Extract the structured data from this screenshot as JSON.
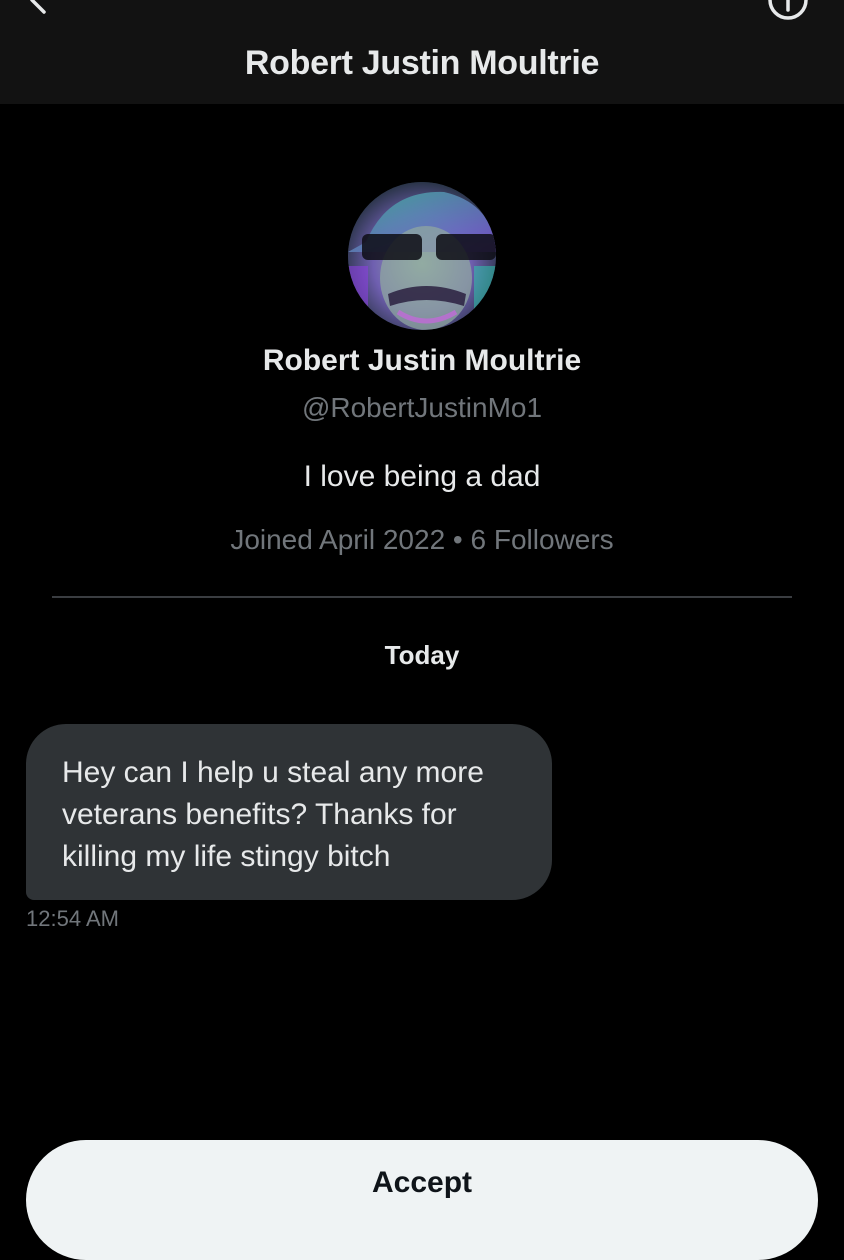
{
  "header": {
    "title": "Robert Justin Moultrie",
    "back_icon": "chevron-left-icon",
    "info_icon": "info-icon"
  },
  "profile": {
    "name": "Robert Justin Moultrie",
    "handle": "@RobertJustinMo1",
    "bio": "I love being a dad",
    "meta": "Joined April 2022 • 6 Followers"
  },
  "conversation": {
    "date_separator": "Today",
    "messages": [
      {
        "text": "Hey can I help u steal any more veterans benefits? Thanks for killing my life stingy bitch",
        "time": "12:54 AM",
        "direction": "incoming"
      }
    ]
  },
  "actions": {
    "accept_label": "Accept"
  },
  "colors": {
    "background": "#000000",
    "header_bg": "#121212",
    "primary_text": "#e7e9ea",
    "secondary_text": "#71767b",
    "bubble_bg": "#2f3336",
    "button_bg": "#eff3f4",
    "button_text": "#0f1419"
  }
}
